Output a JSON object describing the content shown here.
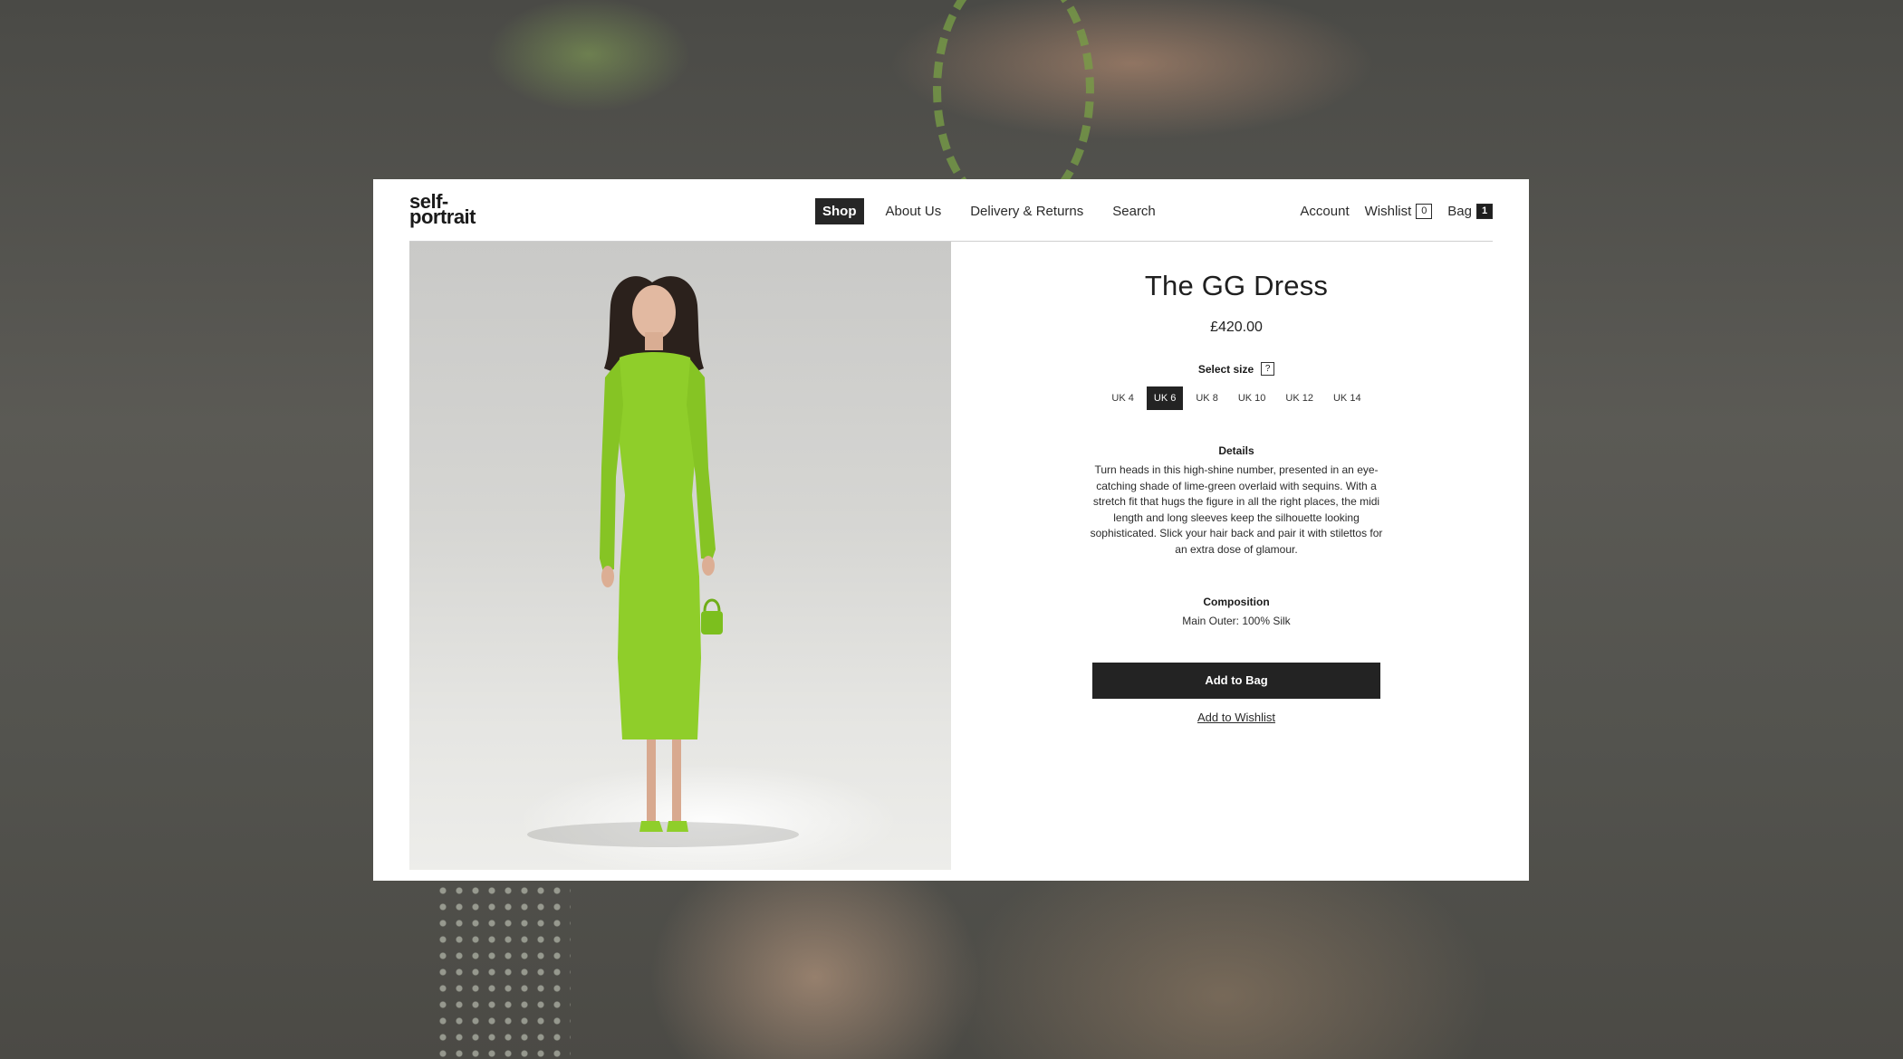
{
  "brand": {
    "logo_line1": "self-",
    "logo_line2": "portrait"
  },
  "nav": {
    "items": [
      {
        "label": "Shop",
        "active": true
      },
      {
        "label": "About Us",
        "active": false
      },
      {
        "label": "Delivery & Returns",
        "active": false
      },
      {
        "label": "Search",
        "active": false
      }
    ]
  },
  "utility": {
    "account_label": "Account",
    "wishlist_label": "Wishlist",
    "wishlist_count": "0",
    "bag_label": "Bag",
    "bag_count": "1"
  },
  "product": {
    "title": "The GG Dress",
    "price": "£420.00",
    "size_label": "Select size",
    "size_help": "?",
    "sizes": [
      {
        "label": "UK 4",
        "selected": false
      },
      {
        "label": "UK 6",
        "selected": true
      },
      {
        "label": "UK 8",
        "selected": false
      },
      {
        "label": "UK 10",
        "selected": false
      },
      {
        "label": "UK 12",
        "selected": false
      },
      {
        "label": "UK 14",
        "selected": false
      }
    ],
    "details_heading": "Details",
    "details_text": "Turn heads in this high-shine number, presented in an eye-catching shade of lime-green overlaid with sequins. With a stretch fit that hugs the figure in all the right places, the midi length and long sleeves keep the silhouette looking sophisticated. Slick your hair back and pair it with stilettos for an extra dose of glamour.",
    "composition_heading": "Composition",
    "composition_text": "Main Outer: 100% Silk",
    "add_to_bag_label": "Add to Bag",
    "add_to_wishlist_label": "Add to Wishlist"
  },
  "colors": {
    "dress_green": "#8fce2a",
    "dark_button": "#232323",
    "backdrop": "#55544f"
  }
}
